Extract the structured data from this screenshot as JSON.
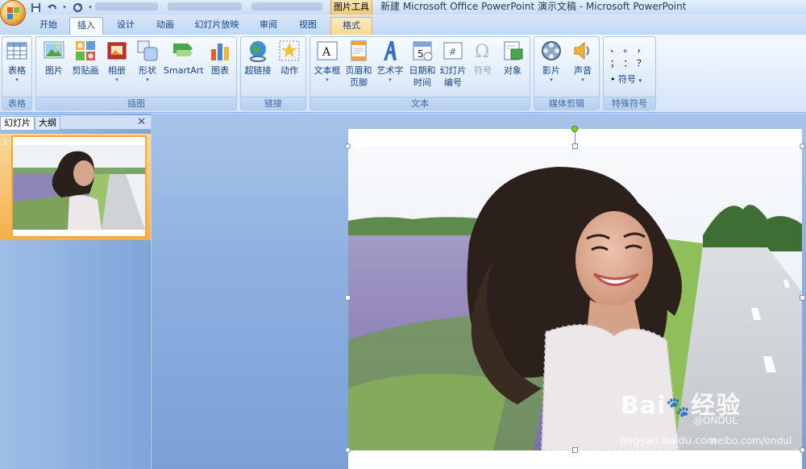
{
  "titlebar": {
    "context_tool": "图片工具",
    "document_title": "新建 Microsoft Office PowerPoint 演示文稿 - Microsoft PowerPoint",
    "qat": [
      "save-icon",
      "undo-icon",
      "redo-icon"
    ]
  },
  "tabs": {
    "home": "开始",
    "insert": "插入",
    "design": "设计",
    "animation": "动画",
    "slideshow": "幻灯片放映",
    "review": "审阅",
    "view": "视图",
    "format": "格式"
  },
  "ribbon": {
    "tables": {
      "label": "表格",
      "table": "表格"
    },
    "illustrations": {
      "label": "插图",
      "picture": "图片",
      "clipart": "剪贴画",
      "album": "相册",
      "shapes": "形状",
      "smartart": "SmartArt",
      "chart": "图表"
    },
    "links": {
      "label": "链接",
      "hyperlink": "超链接",
      "action": "动作"
    },
    "text": {
      "label": "文本",
      "textbox": "文本框",
      "header_footer_1": "页眉和",
      "header_footer_2": "页脚",
      "wordart": "艺术字",
      "datetime_1": "日期和",
      "datetime_2": "时间",
      "slide_number_1": "幻灯片",
      "slide_number_2": "编号",
      "symbol": "符号",
      "object": "对象"
    },
    "media": {
      "label": "媒体剪辑",
      "movie": "影片",
      "sound": "声音"
    },
    "special_symbols": {
      "label": "特殊符号",
      "symbols_row1": "、 。 ，",
      "symbols_row2": "； ： ？",
      "symbol_button": "符号"
    }
  },
  "left_panel": {
    "tab_slides": "幻灯片",
    "tab_outline": "大纲",
    "close": "✕",
    "slide_number": "1"
  },
  "watermark": {
    "brand": "Bai",
    "brand_suffix": "经验",
    "url": "jingyan.baidu.com",
    "credit": "@ONDUL",
    "credit_url": "weibo.com/ondul"
  }
}
